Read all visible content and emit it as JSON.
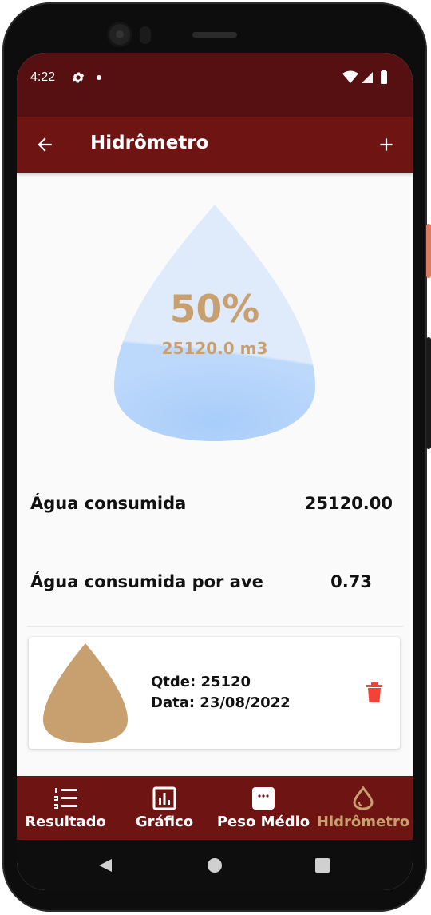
{
  "status": {
    "time": "4:22"
  },
  "appbar": {
    "title": "Hidrômetro"
  },
  "hero": {
    "percent_text": "50%",
    "percent_value": 0.5,
    "volume_text": "25120.0 m3"
  },
  "stats": [
    {
      "label": "Água consumida",
      "value": "25120.00"
    },
    {
      "label": "Água consumida por ave",
      "value": "0.73"
    }
  ],
  "records": [
    {
      "qtde": "Qtde: 25120",
      "data": "Data: 23/08/2022"
    }
  ],
  "nav": {
    "items": [
      {
        "label": "Resultado",
        "icon": "numbered-list-icon"
      },
      {
        "label": "Gráfico",
        "icon": "bar-chart-icon"
      },
      {
        "label": "Peso Médio",
        "icon": "chat-bubble-icon"
      },
      {
        "label": "Hidrômetro",
        "icon": "water-drop-icon",
        "active": true
      }
    ]
  },
  "colors": {
    "status_bar": "#561011",
    "app_bar": "#6e1513",
    "accent": "#c8a06f",
    "delete": "#f44336"
  }
}
